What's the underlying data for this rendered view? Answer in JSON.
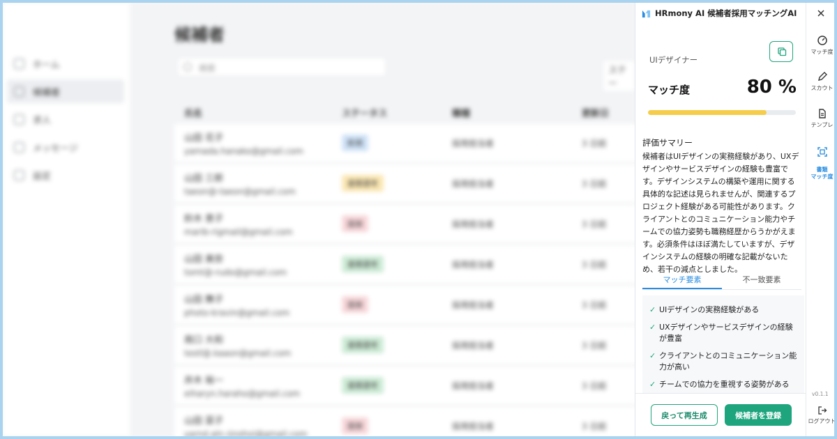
{
  "app": {
    "title": "HRmony AI 候補者採用マッチングAI"
  },
  "background": {
    "page_title": "候補者",
    "search_placeholder": "検索",
    "filter_label": "ステー",
    "nav": [
      {
        "label": "ホーム",
        "icon": "home-icon"
      },
      {
        "label": "候補者",
        "icon": "users-icon"
      },
      {
        "label": "求人",
        "icon": "briefcase-icon"
      },
      {
        "label": "メッセージ",
        "icon": "message-icon"
      },
      {
        "label": "設定",
        "icon": "gear-icon"
      }
    ],
    "columns": [
      "氏名",
      "ステータス",
      "職種",
      "更新日"
    ],
    "rows": [
      {
        "name": "山田 花子",
        "email": "yamada.hanako@gmail.com",
        "status": "新規",
        "status_color": "#cfe2f7",
        "job": "採用担当者",
        "updated": "3 日前"
      },
      {
        "name": "山田 三郎",
        "email": "taeon@-taeon@gmail.com",
        "status": "書類選考",
        "status_color": "#fbe7b3",
        "job": "採用担当者",
        "updated": "3 日前"
      },
      {
        "name": "鈴木 恵子",
        "email": "marib-rigmail@gmail.com",
        "status": "面接",
        "status_color": "#f7d6d9",
        "job": "採用担当者",
        "updated": "3 日前"
      },
      {
        "name": "山田 美奈",
        "email": "tomt@-rudo@gmail.com",
        "status": "書類選考",
        "status_color": "#cdebd6",
        "job": "採用担当者",
        "updated": "3 日前"
      },
      {
        "name": "山田 舞子",
        "email": "photo-kravin@gmail.com",
        "status": "面接",
        "status_color": "#f7d6d9",
        "job": "採用担当者",
        "updated": "3 日前"
      },
      {
        "name": "南口 大和",
        "email": "testl@.kaaon@gmail.com",
        "status": "書類選考",
        "status_color": "#cdebd6",
        "job": "採用担当者",
        "updated": "3 日前"
      },
      {
        "name": "井木 裕一",
        "email": "eiharyn.haraho@gmail.com",
        "status": "書類選考",
        "status_color": "#cdebd6",
        "job": "採用担当者",
        "updated": "3 日前"
      },
      {
        "name": "山田 菜子",
        "email": "yarnd.aln.rjnohoi@gmail.com",
        "status": "面接",
        "status_color": "#f7d6d9",
        "job": "採用担当者",
        "updated": "3 日前"
      }
    ]
  },
  "panel": {
    "job_title": "UIデザイナー",
    "match_label": "マッチ度",
    "match_value": "80 %",
    "match_fraction": 0.8,
    "eval_title": "評価サマリー",
    "eval_text": "候補者はUIデザインの実務経験があり、UXデザインやサービスデザインの経験も豊富です。デザインシステムの構築や運用に関する具体的な記述は見られませんが、関連するプロジェクト経験がある可能性があります。クライアントとのコミュニケーション能力やチームでの協力姿勢も職務経歴からうかがえます。必須条件はほぼ満たしていますが、デザインシステムの経験の明確な記載がないため、若干の減点としました。",
    "tabs": [
      "マッチ要素",
      "不一致要素"
    ],
    "match_items": [
      "UIデザインの実務経験がある",
      "UXデザインやサービスデザインの経験が豊富",
      "クライアントとのコミュニケーション能力が高い",
      "チームでの協力を重視する姿勢がある"
    ],
    "check_mark": "✓",
    "regenerate_label": "戻って再生成",
    "register_label": "候補者を登録"
  },
  "rail": {
    "items": [
      {
        "label": "マッチ度",
        "icon": "gauge-icon"
      },
      {
        "label": "スカウト",
        "icon": "pen-icon"
      },
      {
        "label": "テンプレ",
        "icon": "document-icon"
      },
      {
        "label": "書類\nマッチ度",
        "icon": "scan-icon"
      }
    ],
    "version": "v0.1.1",
    "logout_label": "ログアウト"
  },
  "colors": {
    "accent_green": "#1ea57d",
    "accent_blue": "#2a8de0",
    "match_bar": "#f5cd4b"
  }
}
